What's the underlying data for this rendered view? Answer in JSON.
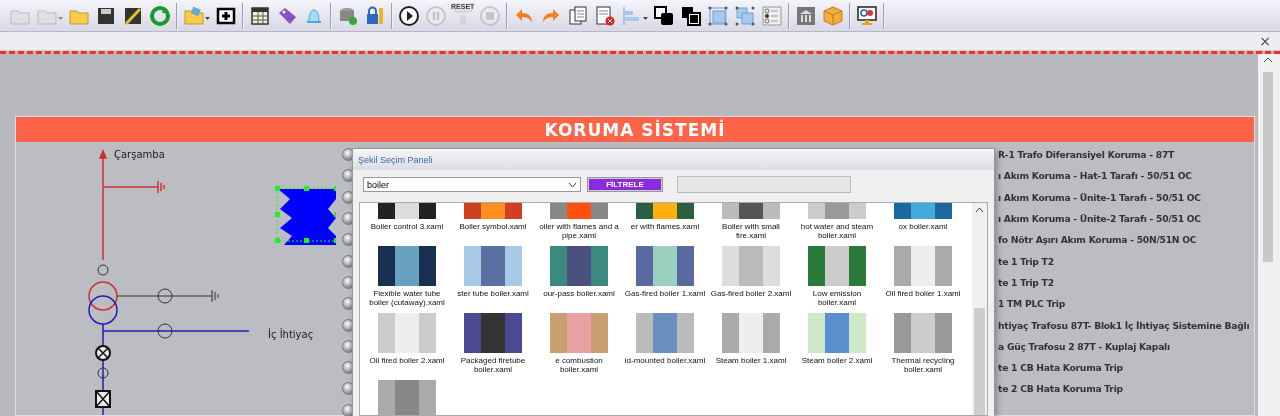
{
  "toolbar": {
    "groups": [
      [
        {
          "disabled": true
        },
        {
          "disabled": true
        },
        {
          "disabled": false
        },
        {
          "disabled": false
        },
        {
          "disabled": false
        },
        {
          "disabled": false
        }
      ],
      [
        {
          "disabled": false
        },
        {
          "disabled": false
        }
      ],
      [
        {
          "disabled": false
        },
        {
          "disabled": false
        },
        {
          "disabled": false
        }
      ],
      [
        {
          "disabled": false
        },
        {
          "disabled": false
        }
      ],
      [
        {
          "disabled": false
        },
        {
          "disabled": true
        },
        {
          "disabled": true,
          "label": "RESET"
        },
        {
          "disabled": true
        }
      ],
      [
        {
          "disabled": false
        },
        {
          "disabled": false
        },
        {
          "disabled": false
        },
        {
          "disabled": false
        },
        {
          "disabled": false
        },
        {
          "disabled": false
        },
        {
          "disabled": false
        },
        {
          "disabled": false
        },
        {
          "disabled": false
        },
        {
          "disabled": false
        }
      ],
      [
        {
          "disabled": false
        },
        {
          "disabled": false
        }
      ],
      [
        {
          "disabled": false
        }
      ]
    ]
  },
  "tab_strip": {
    "close_glyph": "×"
  },
  "panel": {
    "title": "KORUMA SİSTEMİ",
    "diagram": {
      "top_label": "Çarşamba",
      "side_label": "İç İhtiyaç",
      "shape_selected": true
    },
    "rows": [
      {
        "lit": false,
        "label": "R-1 Trafo Diferansiyel Koruma - 87T"
      },
      {
        "lit": false,
        "label": "ı Akım Koruma - Hat-1 Tarafı - 50/51 OC"
      },
      {
        "lit": false,
        "label": "ı Akım Koruma - Ünite-1 Tarafı - 50/51 OC"
      },
      {
        "lit": false,
        "label": "ı Akım Koruma - Ünite-2 Tarafı - 50/51 OC"
      },
      {
        "lit": false,
        "label": "fo Nötr Aşırı Akım Koruma - 50N/51N OC"
      },
      {
        "lit": false,
        "label": "te 1 Trip T2"
      },
      {
        "lit": false,
        "label": "te 1 Trip T2"
      },
      {
        "lit": false,
        "label": "1 TM PLC Trip"
      },
      {
        "lit": false,
        "label": "htiyaç Trafosu 87T- Blok1 İç İhtiyaç Sistemine Bağlı"
      },
      {
        "lit": false,
        "label": "a Güç Trafosu 2 87T - Kuplaj Kapalı"
      },
      {
        "lit": false,
        "label": "te 1 CB Hata Koruma Trip"
      },
      {
        "lit": false,
        "label": "te 2 CB Hata Koruma Trip"
      },
      {
        "lit": false
      }
    ]
  },
  "dialog": {
    "title": "Şekil Seçim Paneli",
    "filter_value": "boiler",
    "filter_button": "FİLTRELE",
    "items": [
      {
        "kind": "labeled",
        "label": "Boiler control 3.xaml"
      },
      {
        "kind": "labeled",
        "label": "Boiler symbol.xaml"
      },
      {
        "kind": "labeled",
        "label": "oiler with flames and a pipe.xaml"
      },
      {
        "kind": "labeled",
        "label": "er with flames.xaml"
      },
      {
        "kind": "labeled",
        "label": "Boiler with small fire.xaml"
      },
      {
        "kind": "labeled",
        "label": "hot water and steam boiler.xaml"
      },
      {
        "kind": "labeled",
        "label": "ox boiler.xaml"
      },
      {
        "kind": "labeled",
        "label": "Flexible water tube boiler (cutaway).xaml"
      },
      {
        "kind": "labeled",
        "label": "ster tube boiler.xaml"
      },
      {
        "kind": "labeled",
        "label": "our-pass boiler.xaml"
      },
      {
        "kind": "labeled",
        "label": "Gas-fired boiler 1.xaml"
      },
      {
        "kind": "labeled",
        "label": "Gas-fired boiler 2.xaml"
      },
      {
        "kind": "labeled",
        "label": "Low emission boiler.xaml"
      },
      {
        "kind": "labeled",
        "label": "Oil fired boiler 1.xaml"
      },
      {
        "kind": "labeled",
        "label": "Oil fired boiler 2.xaml"
      },
      {
        "kind": "labeled",
        "label": "Packaged firetube boiler.xaml"
      },
      {
        "kind": "labeled",
        "label": "e combustion boiler.xaml"
      },
      {
        "kind": "labeled",
        "label": "id-mounted boiler.xaml"
      },
      {
        "kind": "labeled",
        "label": "Steam boiler 1.xaml"
      },
      {
        "kind": "labeled",
        "label": "Steam boiler 2.xaml"
      },
      {
        "kind": "labeled",
        "label": "Thermal recycling boiler.xaml"
      },
      {
        "kind": "image_only"
      }
    ]
  }
}
